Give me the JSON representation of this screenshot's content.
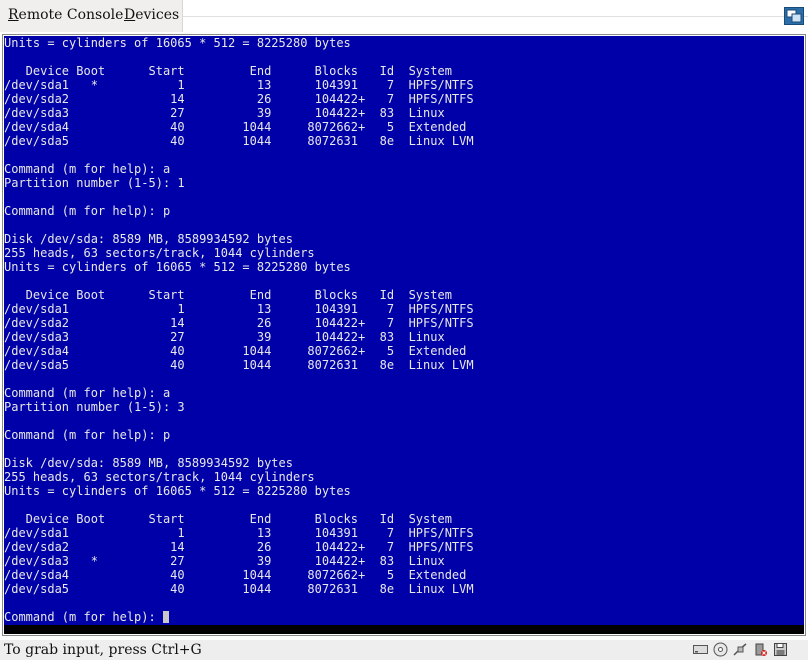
{
  "menu": {
    "remote_console": "Remote Console",
    "remote_console_accel": "R",
    "remote_console_rest": "emote Console",
    "devices": "Devices",
    "devices_accel": "D",
    "devices_rest": "evices"
  },
  "terminal": {
    "lines": [
      "Units = cylinders of 16065 * 512 = 8225280 bytes",
      "",
      "   Device Boot      Start         End      Blocks   Id  System",
      "/dev/sda1   *           1          13      104391    7  HPFS/NTFS",
      "/dev/sda2              14          26      104422+   7  HPFS/NTFS",
      "/dev/sda3              27          39      104422+  83  Linux",
      "/dev/sda4              40        1044     8072662+   5  Extended",
      "/dev/sda5              40        1044     8072631   8e  Linux LVM",
      "",
      "Command (m for help): a",
      "Partition number (1-5): 1",
      "",
      "Command (m for help): p",
      "",
      "Disk /dev/sda: 8589 MB, 8589934592 bytes",
      "255 heads, 63 sectors/track, 1044 cylinders",
      "Units = cylinders of 16065 * 512 = 8225280 bytes",
      "",
      "   Device Boot      Start         End      Blocks   Id  System",
      "/dev/sda1               1          13      104391    7  HPFS/NTFS",
      "/dev/sda2              14          26      104422+   7  HPFS/NTFS",
      "/dev/sda3              27          39      104422+  83  Linux",
      "/dev/sda4              40        1044     8072662+   5  Extended",
      "/dev/sda5              40        1044     8072631   8e  Linux LVM",
      "",
      "Command (m for help): a",
      "Partition number (1-5): 3",
      "",
      "Command (m for help): p",
      "",
      "Disk /dev/sda: 8589 MB, 8589934592 bytes",
      "255 heads, 63 sectors/track, 1044 cylinders",
      "Units = cylinders of 16065 * 512 = 8225280 bytes",
      "",
      "   Device Boot      Start         End      Blocks   Id  System",
      "/dev/sda1               1          13      104391    7  HPFS/NTFS",
      "/dev/sda2              14          26      104422+   7  HPFS/NTFS",
      "/dev/sda3   *          27          39      104422+  83  Linux",
      "/dev/sda4              40        1044     8072662+   5  Extended",
      "/dev/sda5              40        1044     8072631   8e  Linux LVM",
      "",
      "Command (m for help): "
    ]
  },
  "statusbar": {
    "message": "To grab input, press Ctrl+G"
  },
  "icons": {
    "fullscreen": "fullscreen-icon",
    "hdd": "hard-disk-icon",
    "cdrom": "cdrom-icon",
    "network": "network-icon",
    "usb": "usb-icon",
    "floppy": "floppy-icon"
  },
  "colors": {
    "console_bg": "#0000a8",
    "console_fg": "#e8e8e8"
  }
}
